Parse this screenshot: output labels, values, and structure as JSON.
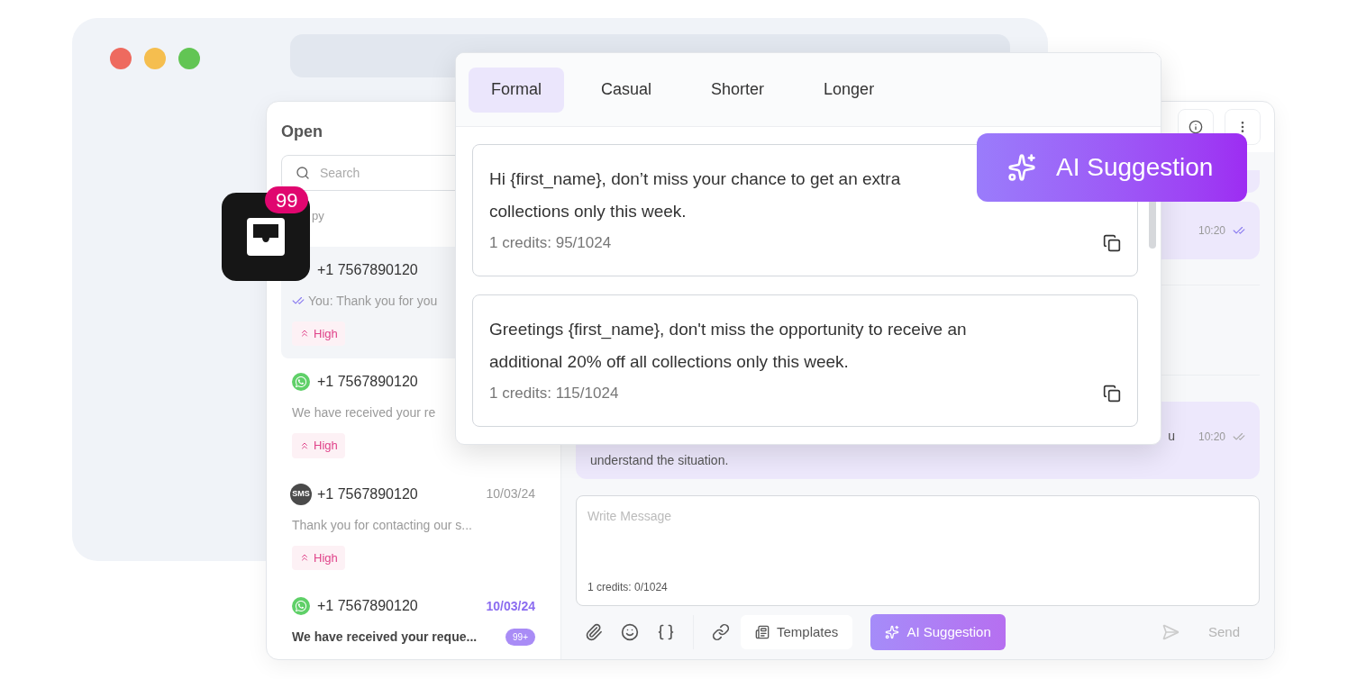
{
  "inbox": {
    "title": "Open",
    "search": {
      "placeholder": "Search"
    },
    "filter_label": "py",
    "conversations": [
      {
        "phone": "+1 7567890120",
        "preview": "You: Thank you for you",
        "sent": true,
        "priority": "High",
        "selected": true,
        "unread": false
      },
      {
        "kind": "whatsapp",
        "phone": "+1 7567890120",
        "preview": "We have received your re",
        "sent": false,
        "priority": "High",
        "selected": false,
        "unread": false
      },
      {
        "kind": "sms",
        "channel_label": "SMS",
        "phone": "+1 7567890120",
        "date": "10/03/24",
        "preview": "Thank you for contacting our s...",
        "sent": false,
        "priority": "High",
        "selected": false,
        "unread": false
      },
      {
        "kind": "whatsapp",
        "phone": "+1 7567890120",
        "date": "10/03/24",
        "preview": "We have received your reque...",
        "sent": false,
        "count": "99+",
        "selected": false,
        "unread": true
      }
    ]
  },
  "badge_count": "99",
  "chat": {
    "messages": [
      {
        "time": "10:20",
        "read": true
      },
      {
        "lines": [
          "u",
          "understand the situation."
        ],
        "time": "10:20",
        "read": false
      }
    ],
    "composer": {
      "placeholder": "Write Message",
      "credits": "1 credits: 0/1024"
    },
    "toolbar": {
      "templates": "Templates",
      "ai": "AI Suggestion",
      "send": "Send"
    }
  },
  "suggestions": {
    "tabs": [
      {
        "label": "Formal",
        "selected": true
      },
      {
        "label": "Casual",
        "selected": false
      },
      {
        "label": "Shorter",
        "selected": false
      },
      {
        "label": "Longer",
        "selected": false
      }
    ],
    "items": [
      {
        "lines": [
          "Hi {first_name}, don’t miss your chance to get an extra",
          "collections only this week."
        ],
        "credits": "1 credits: 95/1024"
      },
      {
        "lines": [
          "Greetings {first_name}, don't miss the opportunity to receive an",
          "additional 20% off all collections only this week."
        ],
        "credits": "1 credits: 115/1024"
      }
    ]
  },
  "ai_badge": "AI Suggestion"
}
